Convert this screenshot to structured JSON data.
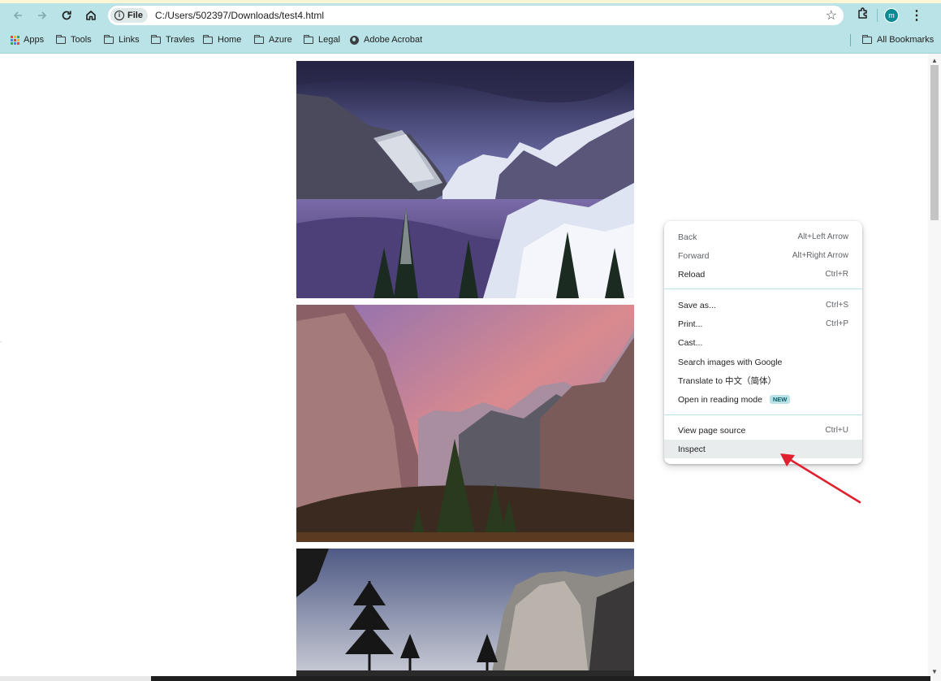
{
  "browser": {
    "omnibox": {
      "scheme_chip": "File",
      "url": "C:/Users/502397/Downloads/test4.html"
    },
    "profile_initial": "m",
    "bookmarks": [
      {
        "label": "Apps",
        "icon": "apps-grid-icon"
      },
      {
        "label": "Tools",
        "icon": "folder-icon"
      },
      {
        "label": "Links",
        "icon": "folder-icon"
      },
      {
        "label": "Travles",
        "icon": "folder-icon"
      },
      {
        "label": "Home",
        "icon": "folder-icon"
      },
      {
        "label": "Azure",
        "icon": "folder-icon"
      },
      {
        "label": "Legal",
        "icon": "folder-icon"
      },
      {
        "label": "Adobe Acrobat",
        "icon": "globe-icon"
      }
    ],
    "all_bookmarks": "All Bookmarks",
    "accent_color": "#b9e3e6"
  },
  "page": {
    "images": [
      "winter-valley-photo",
      "sunset-valley-photo",
      "cliff-trees-photo"
    ]
  },
  "context_menu": {
    "groups": [
      [
        {
          "label": "Back",
          "shortcut": "Alt+Left Arrow",
          "enabled": false
        },
        {
          "label": "Forward",
          "shortcut": "Alt+Right Arrow",
          "enabled": false
        },
        {
          "label": "Reload",
          "shortcut": "Ctrl+R",
          "enabled": true
        }
      ],
      [
        {
          "label": "Save as...",
          "shortcut": "Ctrl+S",
          "enabled": true
        },
        {
          "label": "Print...",
          "shortcut": "Ctrl+P",
          "enabled": true
        },
        {
          "label": "Cast...",
          "shortcut": "",
          "enabled": true
        },
        {
          "label": "Search images with Google",
          "shortcut": "",
          "enabled": true
        },
        {
          "label": "Translate to 中文（简体）",
          "shortcut": "",
          "enabled": true
        },
        {
          "label": "Open in reading mode",
          "shortcut": "",
          "enabled": true,
          "badge": "NEW"
        }
      ],
      [
        {
          "label": "View page source",
          "shortcut": "Ctrl+U",
          "enabled": true
        },
        {
          "label": "Inspect",
          "shortcut": "",
          "enabled": true,
          "highlighted": true
        }
      ]
    ]
  },
  "annotation": {
    "arrow_color": "#e0202e",
    "points_to": "Inspect"
  }
}
